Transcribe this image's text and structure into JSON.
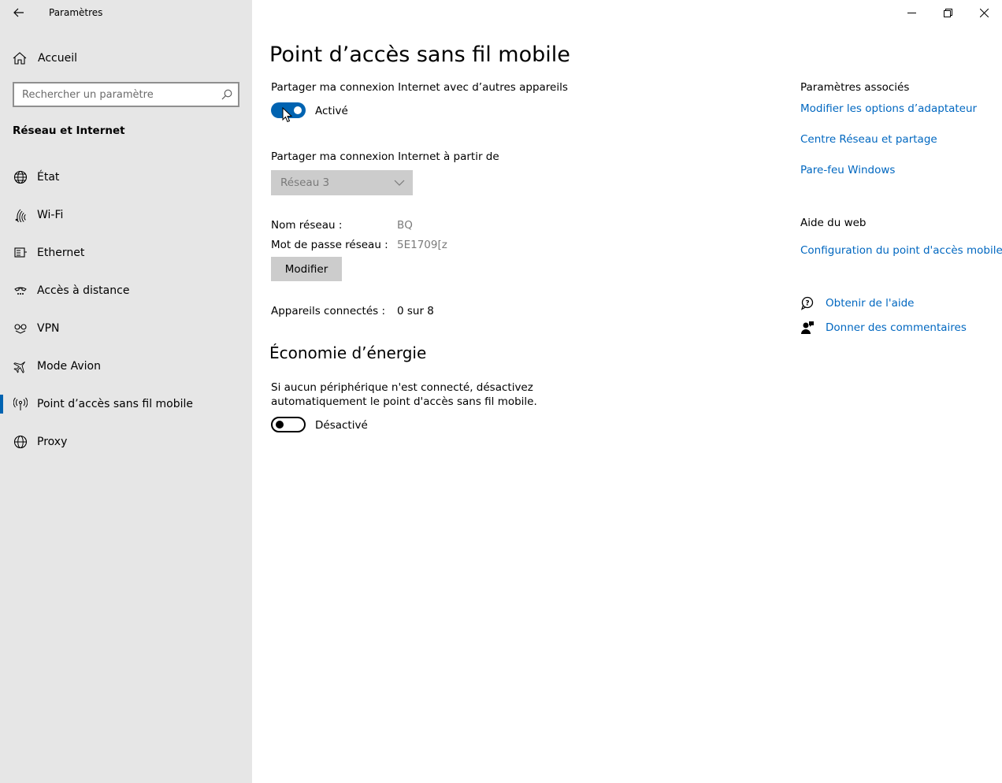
{
  "colors": {
    "accent": "#0063b1",
    "link": "#0067c0"
  },
  "window": {
    "app_title": "Paramètres",
    "controls": {
      "minimize": "minimize-icon",
      "restore": "restore-icon",
      "close": "close-icon"
    }
  },
  "sidebar": {
    "home_label": "Accueil",
    "search_placeholder": "Rechercher un paramètre",
    "search_value": "",
    "section_title": "Réseau et Internet",
    "items": [
      {
        "label": "État",
        "icon": "globe-status-icon"
      },
      {
        "label": "Wi-Fi",
        "icon": "wifi-icon"
      },
      {
        "label": "Ethernet",
        "icon": "ethernet-icon"
      },
      {
        "label": "Accès à distance",
        "icon": "dial-up-icon"
      },
      {
        "label": "VPN",
        "icon": "vpn-icon"
      },
      {
        "label": "Mode Avion",
        "icon": "airplane-icon"
      },
      {
        "label": "Point d’accès sans fil mobile",
        "icon": "hotspot-icon",
        "active": true
      },
      {
        "label": "Proxy",
        "icon": "globe-icon"
      }
    ]
  },
  "main": {
    "title": "Point d’accès sans fil mobile",
    "share_label": "Partager ma connexion Internet avec d’autres appareils",
    "share_toggle": {
      "on": true,
      "state_label": "Activé"
    },
    "share_from_label": "Partager ma connexion Internet à partir de",
    "share_from_value": "Réseau 3",
    "network_name_label": "Nom réseau :",
    "network_name_value": "BQ",
    "password_label": "Mot de passe réseau :",
    "password_value": "5E1709[z",
    "modify_button": "Modifier",
    "connected_label": "Appareils connectés :",
    "connected_value": "0 sur 8",
    "energy_title": "Économie d’énergie",
    "energy_desc": "Si aucun périphérique n'est connecté, désactivez automatiquement le point d'accès sans fil mobile.",
    "energy_toggle": {
      "on": false,
      "state_label": "Désactivé"
    }
  },
  "right": {
    "related_title": "Paramètres associés",
    "related_links": [
      "Modifier les options d’adaptateur",
      "Centre Réseau et partage",
      "Pare-feu Windows"
    ],
    "web_help_title": "Aide du web",
    "web_help_link": "Configuration du point d'accès mobile",
    "get_help": "Obtenir de l'aide",
    "feedback": "Donner des commentaires"
  }
}
